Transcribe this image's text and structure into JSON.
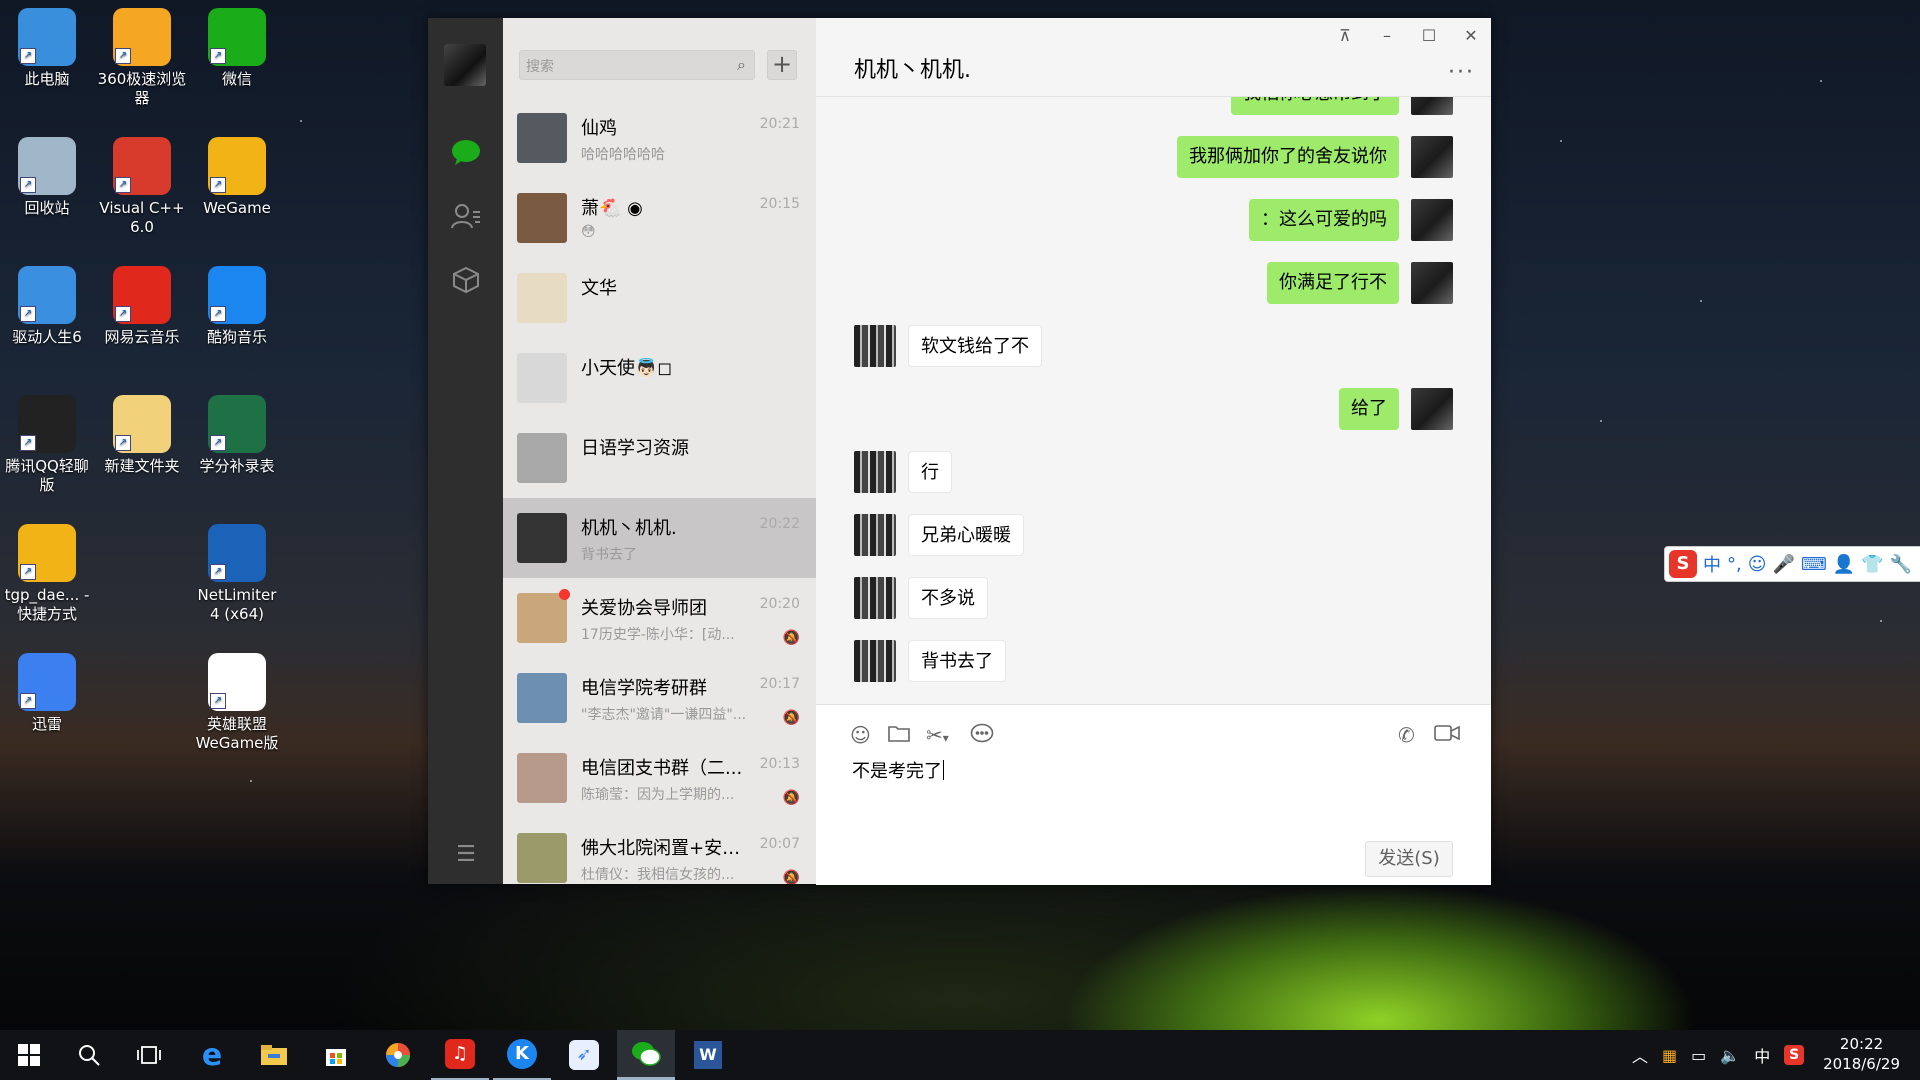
{
  "desktop": {
    "icons": [
      {
        "label": "此电脑",
        "icon": "computer-icon",
        "color": "#3a8fdc"
      },
      {
        "label": "360极速浏览器",
        "icon": "browser-360-icon",
        "color": "#f5a623"
      },
      {
        "label": "微信",
        "icon": "wechat-icon",
        "color": "#1aad19"
      },
      {
        "label": "回收站",
        "icon": "recycle-bin-icon",
        "color": "#9fb7c9"
      },
      {
        "label": "Visual C++ 6.0",
        "icon": "visual-cpp-icon",
        "color": "#d83b2b"
      },
      {
        "label": "WeGame",
        "icon": "wegame-icon",
        "color": "#f2b316"
      },
      {
        "label": "驱动人生6",
        "icon": "driver-gear-icon",
        "color": "#3b8fe0"
      },
      {
        "label": "网易云音乐",
        "icon": "netease-music-icon",
        "color": "#e0281c"
      },
      {
        "label": "酷狗音乐",
        "icon": "kugou-music-icon",
        "color": "#1b86f0"
      },
      {
        "label": "腾讯QQ轻聊版",
        "icon": "qq-penguin-icon",
        "color": "#222222"
      },
      {
        "label": "新建文件夹",
        "icon": "folder-icon",
        "color": "#f1d27a"
      },
      {
        "label": "学分补录表",
        "icon": "excel-file-icon",
        "color": "#1e7145"
      },
      {
        "label": "tgp_dae... - 快捷方式",
        "icon": "tgp-icon",
        "color": "#f2b316"
      },
      {
        "label": "NetLimiter 4 (x64)",
        "icon": "netlimiter-icon",
        "color": "#1a63b8"
      },
      {
        "label": "迅雷",
        "icon": "xunlei-bird-icon",
        "color": "#3c7ff0"
      },
      {
        "label": "英雄联盟 WeGame版",
        "icon": "blank-file-icon",
        "color": "#ffffff"
      }
    ]
  },
  "wechat": {
    "search_placeholder": "搜索",
    "add_label": "+",
    "chats": [
      {
        "name": "仙鸡",
        "preview": "哈哈哈哈哈哈",
        "time": "20:21",
        "muted": false,
        "unread": false,
        "active": false,
        "avatar": "#555a60"
      },
      {
        "name": "萧🐔 ◉",
        "preview": "😳",
        "time": "20:15",
        "muted": false,
        "unread": false,
        "active": false,
        "avatar": "#7a5a40"
      },
      {
        "name": "文华",
        "preview": "",
        "time": "",
        "muted": false,
        "unread": false,
        "active": false,
        "avatar": "#e7dcc3"
      },
      {
        "name": "小天使👼🏻◻",
        "preview": "",
        "time": "",
        "muted": false,
        "unread": false,
        "active": false,
        "avatar": "#d8d8d8"
      },
      {
        "name": "日语学习资源",
        "preview": "",
        "time": "",
        "muted": false,
        "unread": false,
        "active": false,
        "avatar": "#a8a8a8"
      },
      {
        "name": "机机丶机机.",
        "preview": "背书去了",
        "time": "20:22",
        "muted": false,
        "unread": false,
        "active": true,
        "avatar": "#333333"
      },
      {
        "name": "关爱协会导师团",
        "preview": "17历史学-陈小华：[动...",
        "time": "20:20",
        "muted": true,
        "unread": true,
        "active": false,
        "avatar": "#c9a77a"
      },
      {
        "name": "电信学院考研群",
        "preview": "\"李志杰\"邀请\"一谦四益\"...",
        "time": "20:17",
        "muted": true,
        "unread": false,
        "active": false,
        "avatar": "#6d8fb0"
      },
      {
        "name": "电信团支书群（二...",
        "preview": "陈瑜莹：因为上学期的...",
        "time": "20:13",
        "muted": true,
        "unread": false,
        "active": false,
        "avatar": "#b89a8a"
      },
      {
        "name": "佛大北院闲置+安利...",
        "preview": "杜倩仪：我相信女孩的...",
        "time": "20:07",
        "muted": true,
        "unread": false,
        "active": false,
        "avatar": "#9a9a6a"
      }
    ],
    "conversation": {
      "title": "机机丶机机.",
      "more_label": "···",
      "messages": [
        {
          "from": "me",
          "text": "我怕你心急吊到了"
        },
        {
          "from": "me",
          "text": "我那俩加你了的舍友说你"
        },
        {
          "from": "me",
          "text": "：这么可爱的吗"
        },
        {
          "from": "me",
          "text": "你满足了行不"
        },
        {
          "from": "other",
          "text": "软文钱给了不"
        },
        {
          "from": "me",
          "text": "给了"
        },
        {
          "from": "other",
          "text": "行"
        },
        {
          "from": "other",
          "text": "兄弟心暖暖"
        },
        {
          "from": "other",
          "text": "不多说"
        },
        {
          "from": "other",
          "text": "背书去了"
        }
      ],
      "input_text": "不是考完了",
      "send_label": "发送(S)"
    },
    "window_controls": {
      "pin": "⊼",
      "minimize": "–",
      "maximize": "☐",
      "close": "✕"
    }
  },
  "ime_toolbar": {
    "brand": "S",
    "mode": "中",
    "punct": "°,"
  },
  "taskbar": {
    "tray_ime": "中",
    "time": "20:22",
    "date": "2018/6/29"
  },
  "colors": {
    "wechat_green": "#1aad19",
    "bubble_me": "#9eea6a",
    "nav_bg": "#2e2e2e",
    "list_bg": "#e9e8e7"
  }
}
